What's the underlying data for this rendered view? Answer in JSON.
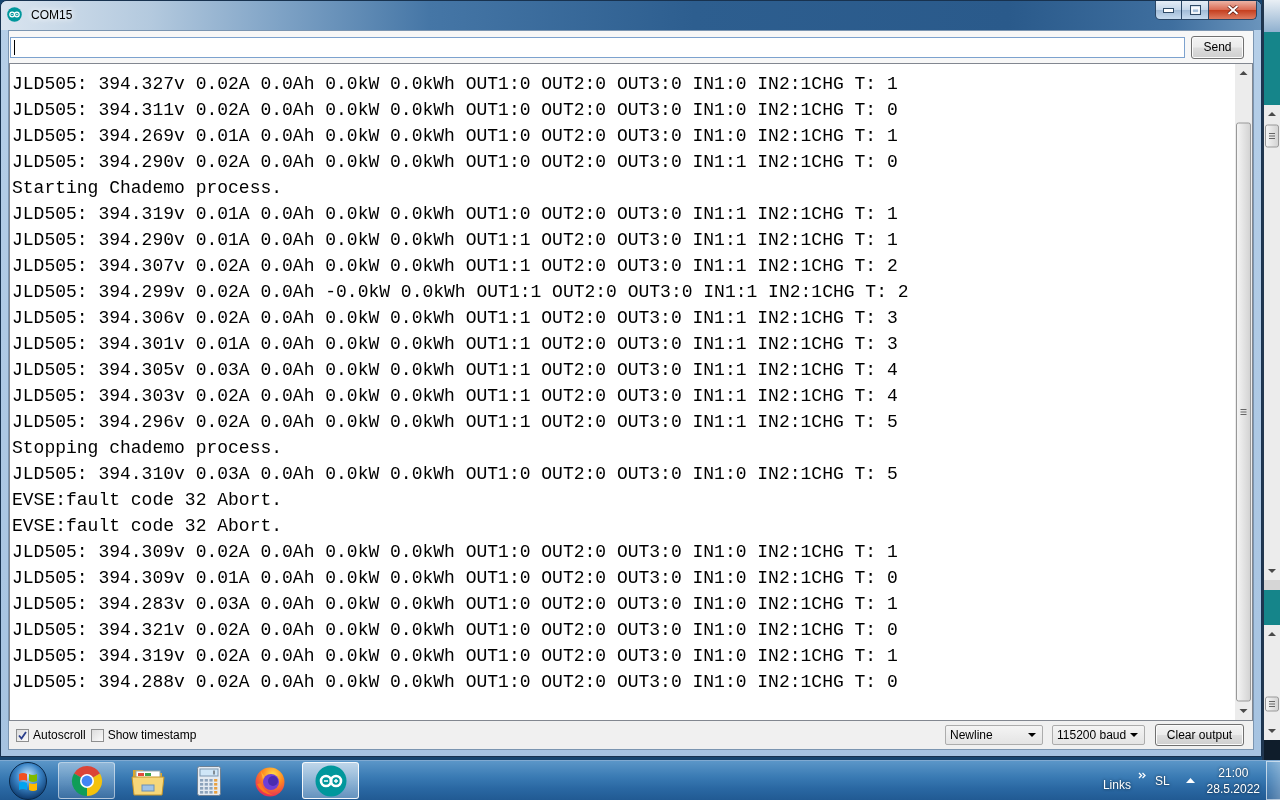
{
  "window": {
    "title": "COM15"
  },
  "send_bar": {
    "focused": true,
    "send_button": "Send"
  },
  "output": {
    "lines": [
      "JLD505: 394.327v 0.02A 0.0Ah 0.0kW 0.0kWh OUT1:0 OUT2:0 OUT3:0 IN1:0 IN2:1CHG T: 1",
      "JLD505: 394.311v 0.02A 0.0Ah 0.0kW 0.0kWh OUT1:0 OUT2:0 OUT3:0 IN1:0 IN2:1CHG T: 0",
      "JLD505: 394.269v 0.01A 0.0Ah 0.0kW 0.0kWh OUT1:0 OUT2:0 OUT3:0 IN1:0 IN2:1CHG T: 1",
      "JLD505: 394.290v 0.02A 0.0Ah 0.0kW 0.0kWh OUT1:0 OUT2:0 OUT3:0 IN1:1 IN2:1CHG T: 0",
      "Starting Chademo process.",
      "JLD505: 394.319v 0.01A 0.0Ah 0.0kW 0.0kWh OUT1:0 OUT2:0 OUT3:0 IN1:1 IN2:1CHG T: 1",
      "JLD505: 394.290v 0.01A 0.0Ah 0.0kW 0.0kWh OUT1:1 OUT2:0 OUT3:0 IN1:1 IN2:1CHG T: 1",
      "JLD505: 394.307v 0.02A 0.0Ah 0.0kW 0.0kWh OUT1:1 OUT2:0 OUT3:0 IN1:1 IN2:1CHG T: 2",
      "JLD505: 394.299v 0.02A 0.0Ah -0.0kW 0.0kWh OUT1:1 OUT2:0 OUT3:0 IN1:1 IN2:1CHG T: 2",
      "JLD505: 394.306v 0.02A 0.0Ah 0.0kW 0.0kWh OUT1:1 OUT2:0 OUT3:0 IN1:1 IN2:1CHG T: 3",
      "JLD505: 394.301v 0.01A 0.0Ah 0.0kW 0.0kWh OUT1:1 OUT2:0 OUT3:0 IN1:1 IN2:1CHG T: 3",
      "JLD505: 394.305v 0.03A 0.0Ah 0.0kW 0.0kWh OUT1:1 OUT2:0 OUT3:0 IN1:1 IN2:1CHG T: 4",
      "JLD505: 394.303v 0.02A 0.0Ah 0.0kW 0.0kWh OUT1:1 OUT2:0 OUT3:0 IN1:1 IN2:1CHG T: 4",
      "JLD505: 394.296v 0.02A 0.0Ah 0.0kW 0.0kWh OUT1:1 OUT2:0 OUT3:0 IN1:1 IN2:1CHG T: 5",
      "Stopping chademo process.",
      "JLD505: 394.310v 0.03A 0.0Ah 0.0kW 0.0kWh OUT1:0 OUT2:0 OUT3:0 IN1:0 IN2:1CHG T: 5",
      "EVSE:fault code 32 Abort.",
      "EVSE:fault code 32 Abort.",
      "JLD505: 394.309v 0.02A 0.0Ah 0.0kW 0.0kWh OUT1:0 OUT2:0 OUT3:0 IN1:0 IN2:1CHG T: 1",
      "JLD505: 394.309v 0.01A 0.0Ah 0.0kW 0.0kWh OUT1:0 OUT2:0 OUT3:0 IN1:0 IN2:1CHG T: 0",
      "JLD505: 394.283v 0.03A 0.0Ah 0.0kW 0.0kWh OUT1:0 OUT2:0 OUT3:0 IN1:0 IN2:1CHG T: 1",
      "JLD505: 394.321v 0.02A 0.0Ah 0.0kW 0.0kWh OUT1:0 OUT2:0 OUT3:0 IN1:0 IN2:1CHG T: 0",
      "JLD505: 394.319v 0.02A 0.0Ah 0.0kW 0.0kWh OUT1:0 OUT2:0 OUT3:0 IN1:0 IN2:1CHG T: 1",
      "JLD505: 394.288v 0.02A 0.0Ah 0.0kW 0.0kWh OUT1:0 OUT2:0 OUT3:0 IN1:0 IN2:1CHG T: 0"
    ]
  },
  "footer": {
    "options": [
      {
        "label": "Autoscroll",
        "checked": true
      },
      {
        "label": "Show timestamp",
        "checked": false
      }
    ],
    "line_ending": "Newline",
    "baud_rate": "115200 baud",
    "clear_button": "Clear output"
  },
  "taskbar": {
    "apps": [
      {
        "kind": "globe",
        "running": true,
        "selected": false
      },
      {
        "kind": "folder",
        "running": false,
        "selected": false
      },
      {
        "kind": "calculator",
        "running": false,
        "selected": false
      },
      {
        "kind": "fox",
        "running": false,
        "selected": false
      },
      {
        "kind": "infinity",
        "running": true,
        "selected": true
      }
    ],
    "toolbar_label": "Links",
    "language": "SL",
    "time": "21:00",
    "date": "28.5.2022"
  }
}
